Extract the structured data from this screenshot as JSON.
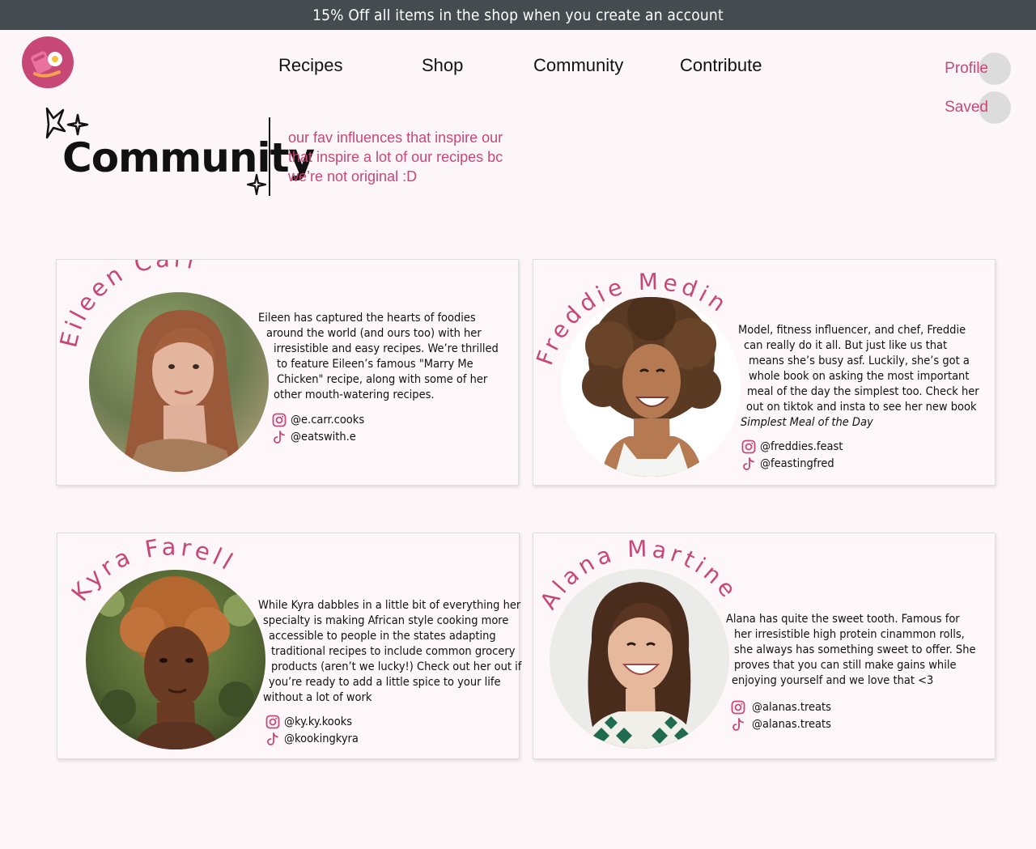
{
  "promo": "15% Off all items in the shop when you create an account",
  "nav": {
    "recipes": "Recipes",
    "shop": "Shop",
    "community": "Community",
    "contribute": "Contribute",
    "profile": "Profile",
    "saved": "Saved"
  },
  "hero": {
    "title": "Community",
    "subtitle_lines": [
      "our fav influences that inspire our",
      "that inspire a lot of our recipes bc",
      "we’re not original :D"
    ]
  },
  "colors": {
    "accent": "#c74876",
    "promo_bg": "#454c4f",
    "page_bg": "#fdf6f8"
  },
  "influencers": [
    {
      "name": "Eileen Carr",
      "bio_lines": [
        "Eileen has captured the hearts of foodies",
        "around the world (and ours too) with her",
        "irresistible and easy recipes.  We’re thrilled",
        "to feature Eileen’s  famous \"Marry Me",
        "Chicken\" recipe, along with some of her",
        "other mouth-watering recipes."
      ],
      "instagram": "@e.carr.cooks",
      "tiktok": "@eatswith.e"
    },
    {
      "name": "Freddie Medina",
      "bio_lines": [
        "Model, fitness influencer, and chef, Freddie",
        "can really do it all. But just like us that",
        "means she’s busy asf. Luckily, she’s got a",
        "whole book on asking the most important",
        "meal of the day the simplest too. Check her",
        "out on tiktok and insta to see her new book"
      ],
      "bio_emphasis": "Simplest Meal of the Day",
      "instagram": "@freddies.feast",
      "tiktok": "@feastingfred"
    },
    {
      "name": "Kyra Farell",
      "bio_lines": [
        "While Kyra dabbles in a little bit of everything her",
        "specialty is making African style cooking more",
        "accessible to people in the states adapting",
        "traditional recipes to include common grocery",
        "products (aren’t we lucky!) Check out her out if",
        "you’re ready to add a little spice to your life",
        "without a lot of work"
      ],
      "instagram": "@ky.ky.kooks",
      "tiktok": "@kookingkyra"
    },
    {
      "name": "Alana Martinez",
      "bio_lines": [
        "Alana has quite the sweet tooth. Famous for",
        "her irresistible high protein cinammon rolls,",
        "she always has something sweet to offer. She",
        "proves that you can still make gains while",
        "enjoying yourself and we love that <3"
      ],
      "instagram": "@alanas.treats",
      "tiktok": "@alanas.treats"
    }
  ]
}
